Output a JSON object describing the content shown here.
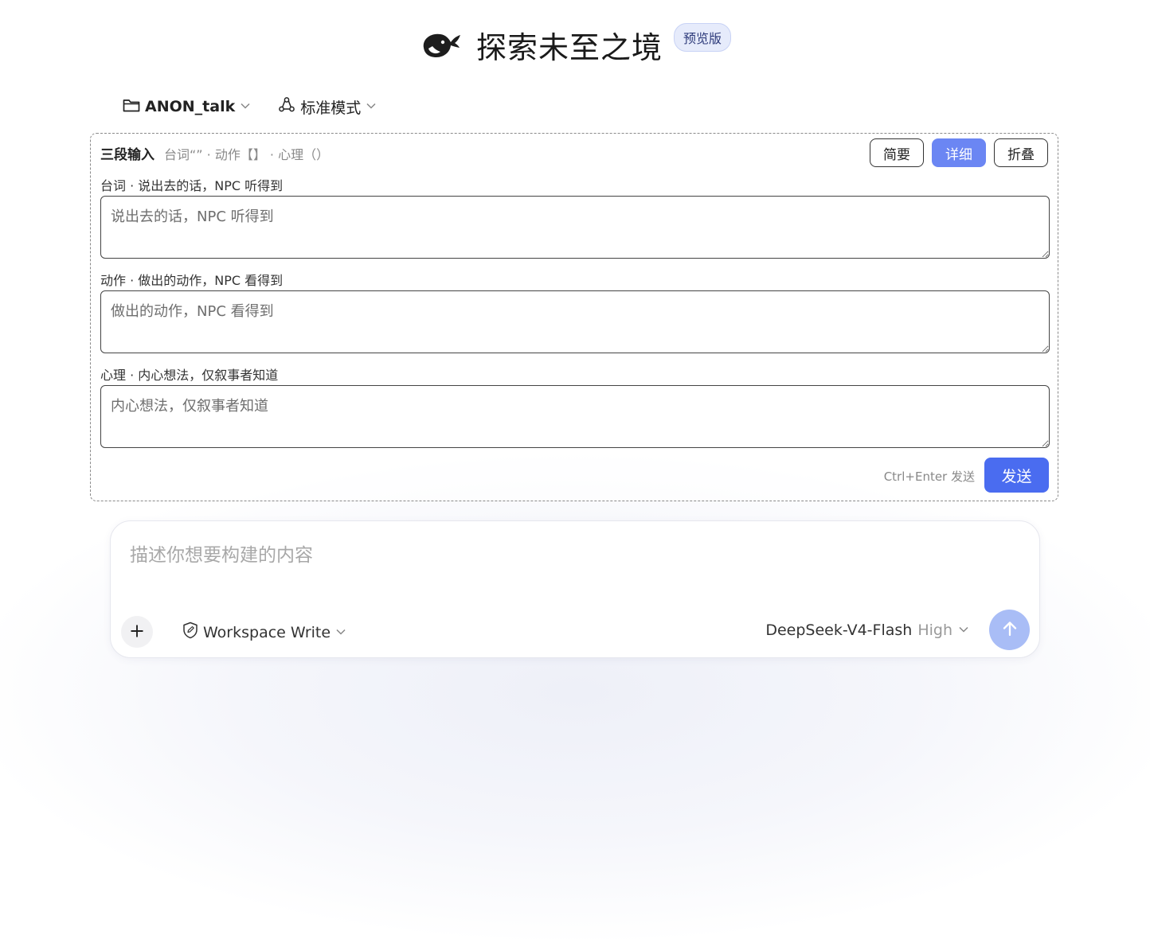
{
  "header": {
    "logo_icon": "whale-icon",
    "title": "探索未至之境",
    "badge": "预览版"
  },
  "toolbar": {
    "project": {
      "icon": "folder-icon",
      "label": "ANON_talk"
    },
    "mode": {
      "icon": "cycle-icon",
      "label": "标准模式"
    }
  },
  "panel": {
    "title": "三段输入",
    "hint": "台词“” · 动作【】 · 心理（）",
    "modes": [
      "简要",
      "详细",
      "折叠"
    ],
    "active_mode": "详细",
    "fields": [
      {
        "label": "台词 · 说出去的话，NPC 听得到",
        "placeholder": "说出去的话，NPC 听得到",
        "value": ""
      },
      {
        "label": "动作 · 做出的动作，NPC 看得到",
        "placeholder": "做出的动作，NPC 看得到",
        "value": ""
      },
      {
        "label": "心理 · 内心想法，仅叙事者知道",
        "placeholder": "内心想法，仅叙事者知道",
        "value": ""
      }
    ],
    "send_hint": "Ctrl+Enter 发送",
    "send_label": "发送"
  },
  "composer": {
    "placeholder": "描述你想要构建的内容",
    "workspace": {
      "icon": "shield-edit-icon",
      "label": "Workspace Write"
    },
    "model": {
      "name": "DeepSeek-V4-Flash",
      "level": "High"
    }
  },
  "colors": {
    "accent": "#4a6cf0",
    "active_mode": "#6b86f3",
    "submit_disabled": "#a9bdf6",
    "badge_bg": "#e6ebfb"
  }
}
